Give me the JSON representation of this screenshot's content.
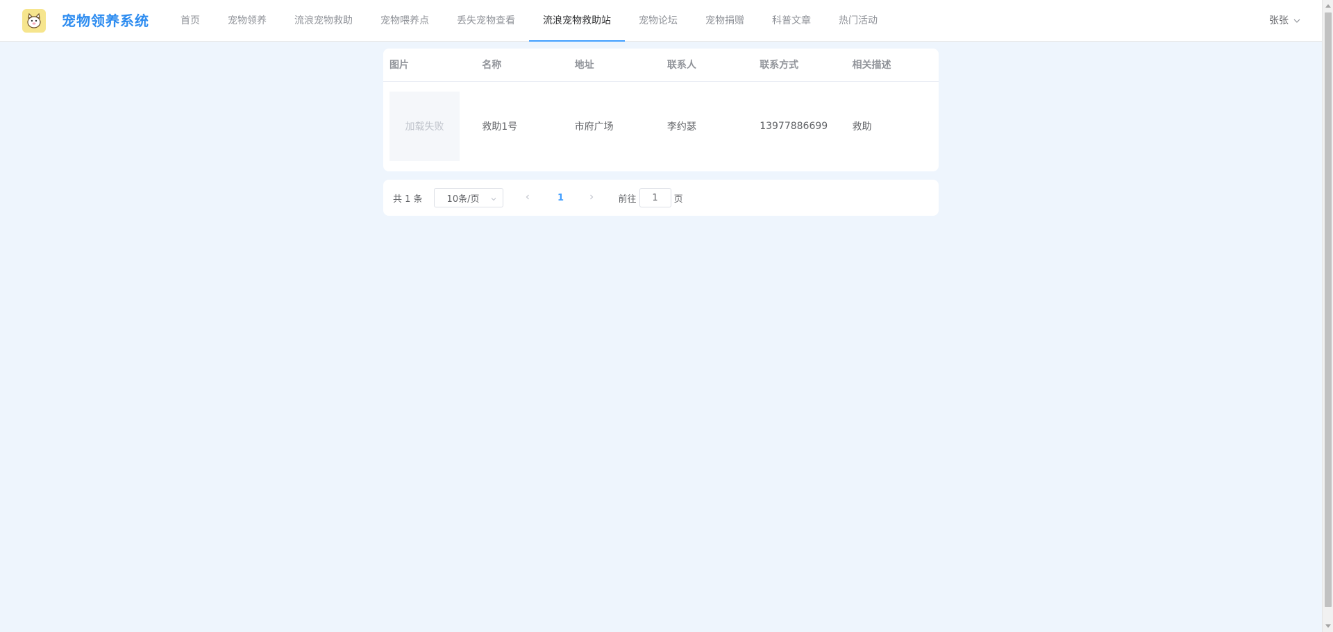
{
  "header": {
    "brand": "宠物领养系统",
    "nav": [
      {
        "label": "首页",
        "active": false
      },
      {
        "label": "宠物领养",
        "active": false
      },
      {
        "label": "流浪宠物救助",
        "active": false
      },
      {
        "label": "宠物喂养点",
        "active": false
      },
      {
        "label": "丢失宠物查看",
        "active": false
      },
      {
        "label": "流浪宠物救助站",
        "active": true
      },
      {
        "label": "宠物论坛",
        "active": false
      },
      {
        "label": "宠物捐赠",
        "active": false
      },
      {
        "label": "科普文章",
        "active": false
      },
      {
        "label": "热门活动",
        "active": false
      }
    ],
    "user": "张张"
  },
  "table": {
    "columns": [
      "图片",
      "名称",
      "地址",
      "联系人",
      "联系方式",
      "相关描述"
    ],
    "rows": [
      {
        "image_text": "加载失败",
        "name": "救助1号",
        "address": "市府广场",
        "contact": "李约瑟",
        "phone": "13977886699",
        "description": "救助"
      }
    ]
  },
  "pagination": {
    "total_text": "共 1 条",
    "page_size": "10条/页",
    "current_page": "1",
    "goto_label": "前往",
    "goto_value": "1",
    "page_suffix": "页"
  },
  "colors": {
    "accent": "#409eff",
    "brand": "#2d8cf0",
    "page_bg": "#eef5fd"
  }
}
